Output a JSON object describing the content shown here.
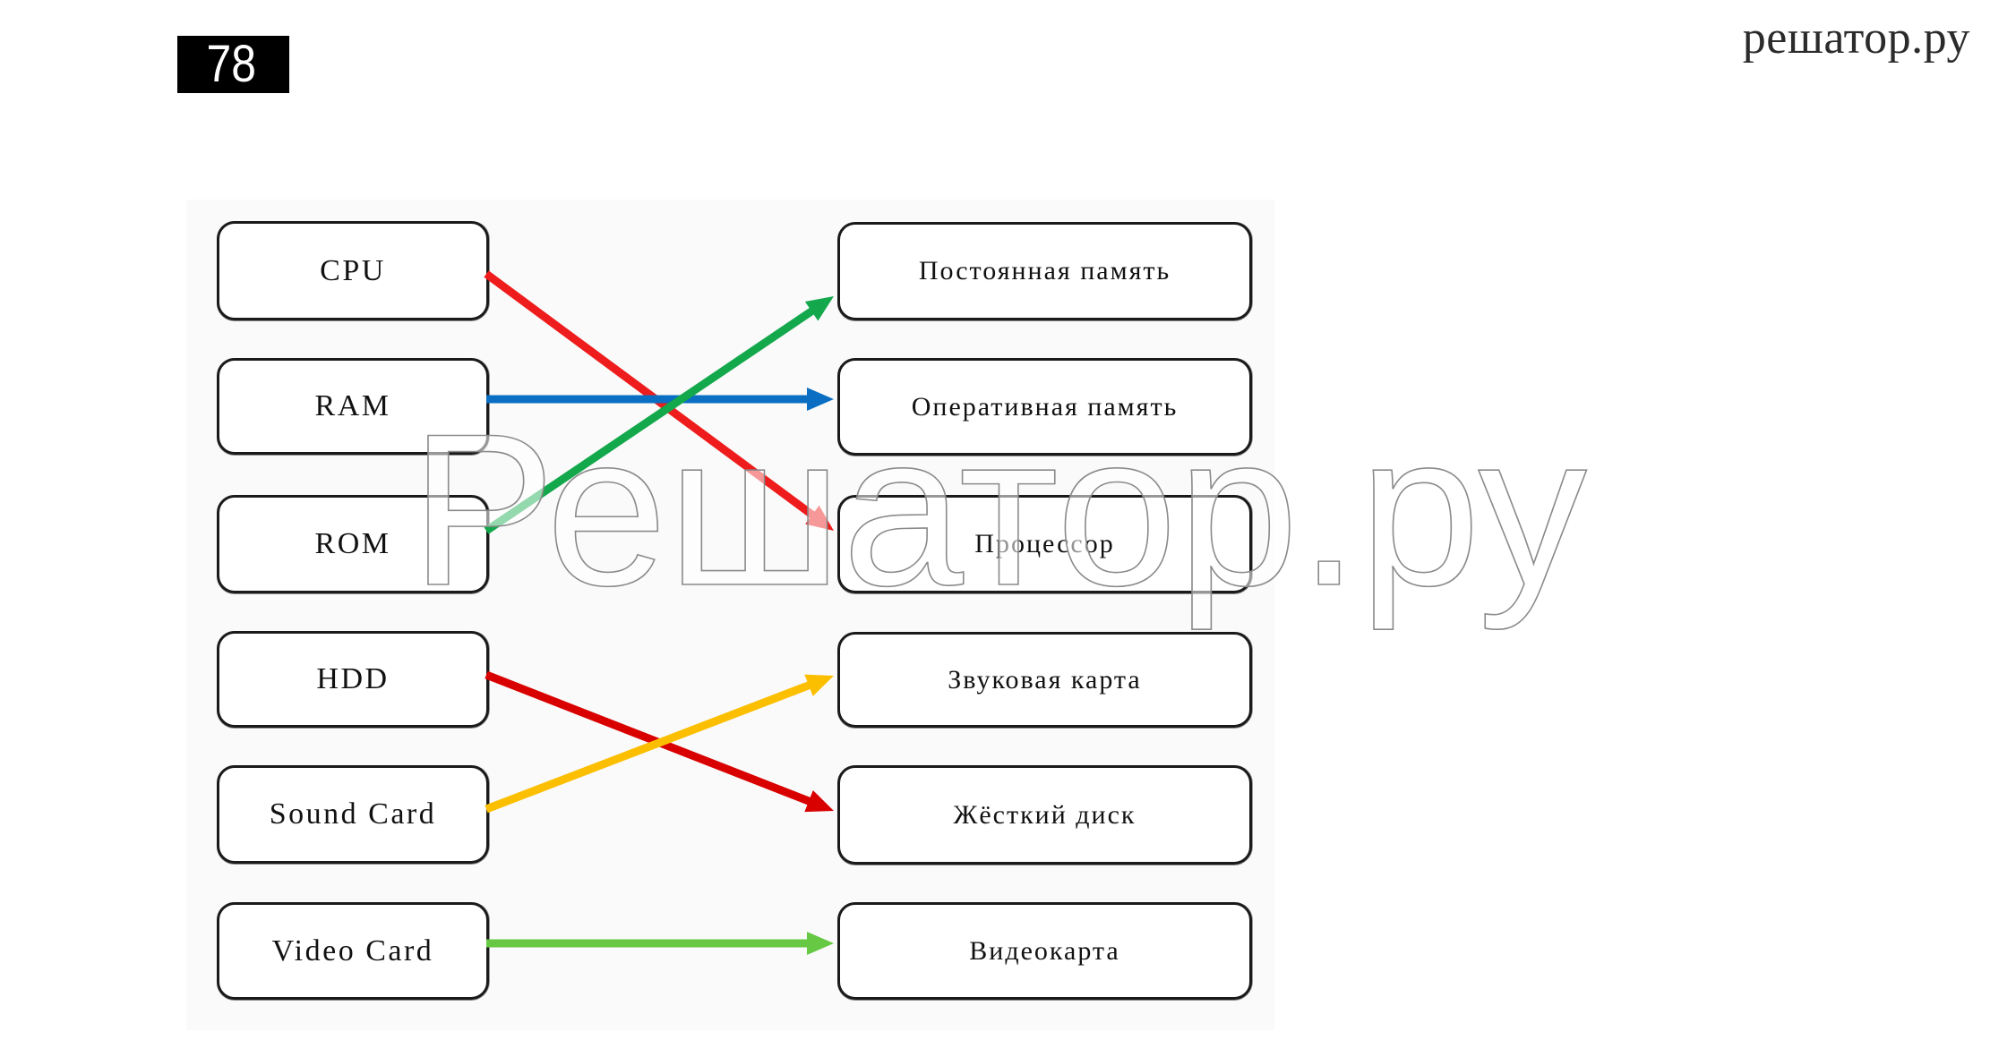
{
  "header": {
    "page_number": "78",
    "site_name": "решатор.ру"
  },
  "watermark": {
    "text": "Решатор.ру"
  },
  "diagram": {
    "left_items": [
      {
        "id": "cpu",
        "label": "CPU"
      },
      {
        "id": "ram",
        "label": "RAM"
      },
      {
        "id": "rom",
        "label": "ROM"
      },
      {
        "id": "hdd",
        "label": "HDD"
      },
      {
        "id": "sound-card",
        "label": "Sound Card"
      },
      {
        "id": "video-card",
        "label": "Video Card"
      }
    ],
    "right_items": [
      {
        "id": "permanent-memory",
        "label": "Постоянная память"
      },
      {
        "id": "operative-memory",
        "label": "Оперативная память"
      },
      {
        "id": "processor",
        "label": "Процессор"
      },
      {
        "id": "sound-card-ru",
        "label": "Звуковая карта"
      },
      {
        "id": "hard-disk",
        "label": "Жёсткий диск"
      },
      {
        "id": "video-card-ru",
        "label": "Видеокарта"
      }
    ],
    "connections": [
      {
        "from": 0,
        "to": 2,
        "color": "#ee1c1c",
        "name": "cpu-to-processor"
      },
      {
        "from": 1,
        "to": 1,
        "color": "#0a6fc2",
        "name": "ram-to-operative-memory"
      },
      {
        "from": 2,
        "to": 0,
        "color": "#13a84b",
        "name": "rom-to-permanent-memory"
      },
      {
        "from": 3,
        "to": 4,
        "color": "#d90000",
        "name": "hdd-to-hard-disk"
      },
      {
        "from": 4,
        "to": 3,
        "color": "#fbbf00",
        "name": "sound-card-to-sound-card-ru"
      },
      {
        "from": 5,
        "to": 5,
        "color": "#66c843",
        "name": "video-card-to-video-card-ru"
      }
    ]
  }
}
